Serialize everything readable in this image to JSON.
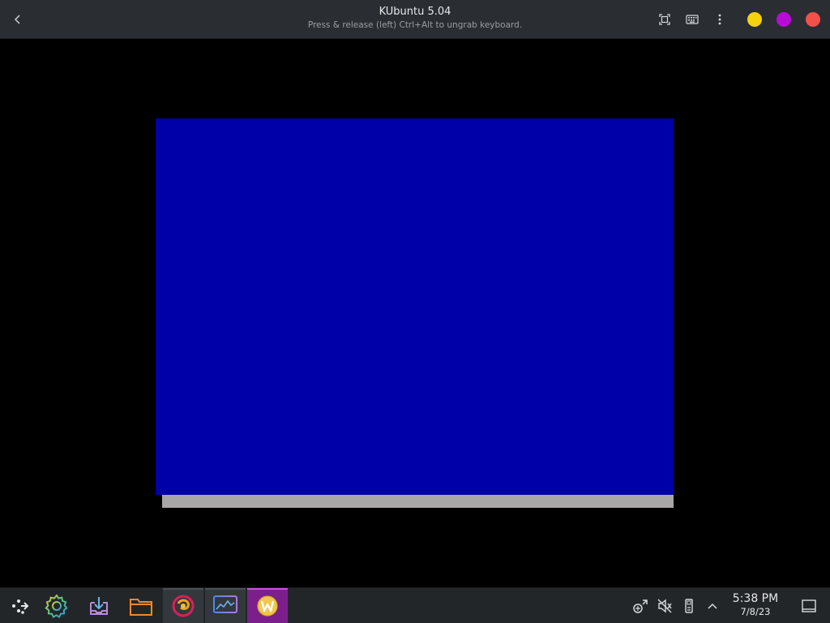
{
  "window": {
    "title": "KUbuntu 5.04",
    "subtitle": "Press & release (left) Ctrl+Alt to ungrab keyboard.",
    "buttons": {
      "back": "back-icon",
      "fullscreen": "fullscreen-icon",
      "keyboard": "keyboard-icon",
      "menu": "kebab-menu-icon"
    },
    "window_controls": [
      {
        "name": "minimize",
        "color": "#f5d20c"
      },
      {
        "name": "maximize",
        "color": "#b80bd6"
      },
      {
        "name": "close",
        "color": "#f2504b"
      }
    ]
  },
  "vm_screen": {
    "background": "#000000",
    "panel_color": "#0000a8",
    "bar_color": "#a8a6a6"
  },
  "taskbar": {
    "apps": [
      {
        "name": "application-launcher",
        "icon": "launcher-arrows-icon",
        "state": "normal"
      },
      {
        "name": "system-settings",
        "icon": "gear-icon",
        "state": "normal"
      },
      {
        "name": "discover",
        "icon": "download-box-icon",
        "state": "normal"
      },
      {
        "name": "dolphin",
        "icon": "folder-icon",
        "state": "normal"
      },
      {
        "name": "firefox",
        "icon": "firefox-icon",
        "state": "running"
      },
      {
        "name": "system-monitor",
        "icon": "monitor-graph-icon",
        "state": "running"
      },
      {
        "name": "virtual-machine",
        "icon": "w-app-icon",
        "state": "active"
      }
    ],
    "tray": {
      "network": "network-icon",
      "volume": "volume-muted-icon",
      "storage": "usb-drive-icon",
      "expand": "chevron-up-icon"
    },
    "clock": {
      "time": "5:38 PM",
      "date": "7/8/23"
    },
    "show_desktop": "show-desktop-icon"
  }
}
